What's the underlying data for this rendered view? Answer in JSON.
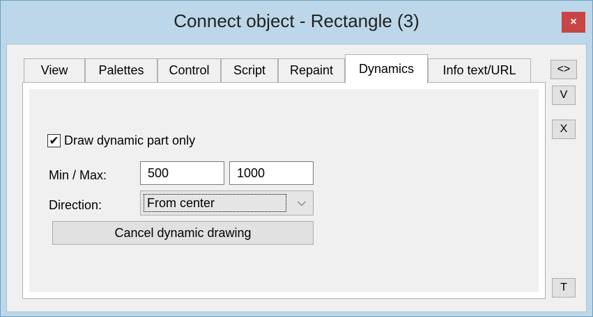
{
  "window": {
    "title": "Connect object - Rectangle (3)",
    "close_label": "×"
  },
  "tabs": [
    {
      "label": "View"
    },
    {
      "label": "Palettes"
    },
    {
      "label": "Control"
    },
    {
      "label": "Script"
    },
    {
      "label": "Repaint"
    },
    {
      "label": "Dynamics",
      "active": true
    },
    {
      "label": "Info text/URL"
    }
  ],
  "side_buttons": {
    "nav": "<>",
    "v": "V",
    "x": "X",
    "t": "T"
  },
  "dynamics": {
    "checkbox_label": "Draw dynamic part only",
    "checkbox_checked": true,
    "checkmark": "✔",
    "minmax_label": "Min / Max:",
    "min_value": "500",
    "max_value": "1000",
    "direction_label": "Direction:",
    "direction_value": "From center",
    "dropdown_glyph": "⌵",
    "cancel_button": "Cancel dynamic drawing"
  }
}
